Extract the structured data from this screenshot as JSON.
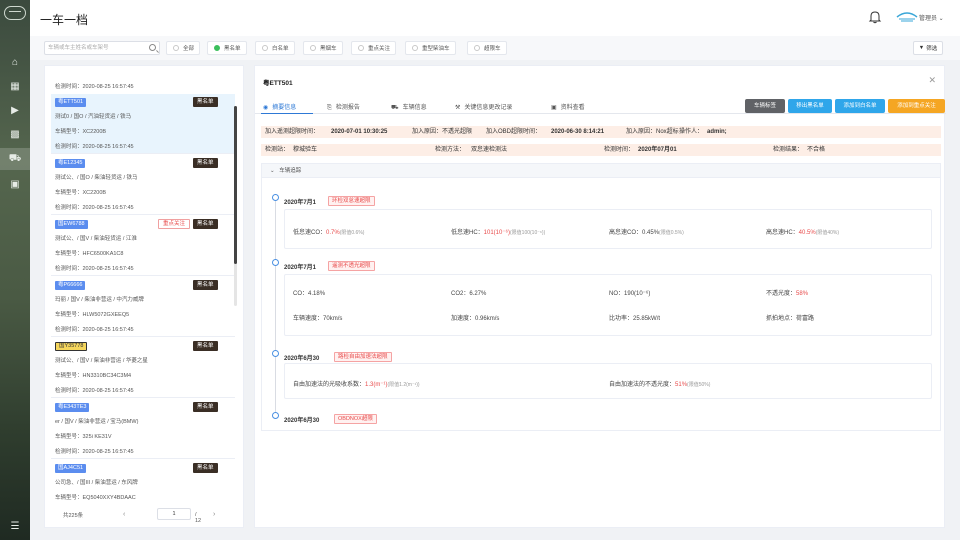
{
  "app": {
    "title": "一车一档",
    "user": "管理员"
  },
  "filters": {
    "search_placeholder": "车辆或车主姓名或车架号",
    "chips": [
      "全部",
      "黑名单",
      "白名单",
      "黑烟车",
      "重点关注",
      "重型柴油车",
      "超限车"
    ],
    "active_chip": "黑名单",
    "filter_button": "筛选"
  },
  "list": {
    "top_partial_line": "检测时间：2020-08-25 16:57:45",
    "items": [
      {
        "plate": "粤ETT501",
        "tag": "黑名单",
        "l1": "测试0 / 国O / 汽油轻货运 / 铁马",
        "l2": "车辆型号：XC2200B",
        "l3": "检测时间：2020-08-25 16:57:45"
      },
      {
        "plate": "粤E12345",
        "tag": "黑名单",
        "l1": "测试公、/ 国O / 柴油轻货运 / 铁马",
        "l2": "车辆型号：XC2200B",
        "l3": "检测时间：2020-08-25 16:57:45"
      },
      {
        "plate": "国EW6788",
        "tag": "黑名单",
        "tag2": "重点关注",
        "l1": "测试公、/ 国V / 柴油轻货运 / 江淮",
        "l2": "车辆型号：HFC6500KA1C8",
        "l3": "检测时间：2020-08-25 16:57:45"
      },
      {
        "plate": "粤P66666",
        "tag": "黑名单",
        "l1": "玛丽 / 国V / 柴油非营运 / 中汽力威牌",
        "l2": "车辆型号：HLW5072GXEEQ5",
        "l3": "检测时间：2020-08-25 16:57:45"
      },
      {
        "plate": "国Y35778",
        "tag": "黑名单",
        "l1": "测试公、/ 国V / 柴油非营运 / 华菱之星",
        "l2": "车辆型号：HN3310BC34C3M4",
        "l3": "检测时间：2020-08-25 16:57:45"
      },
      {
        "plate": "粤E343TE3",
        "tag": "黑名单",
        "l1": "er / 国V / 柴油非营运 / 宝马(BMW)",
        "l2": "车辆型号：325i KE31V",
        "l3": "检测时间：2020-08-25 16:57:45"
      },
      {
        "plate": "国AJ4C51",
        "tag": "黑名单",
        "l1": "公司急、/ 国III / 柴油营运 / 东风牌",
        "l2": "车辆型号：EQ5040XXY4BDAAC",
        "l3": ""
      }
    ],
    "total": "共225条",
    "page": "1",
    "pages": "/ 12"
  },
  "detail": {
    "title": "粤ETT501",
    "tabs": [
      "摘要信息",
      "检测报告",
      "车辆信息",
      "关键信息更改记录",
      "资料查看"
    ],
    "actions": [
      {
        "label": "车辆标签",
        "color": "#606266"
      },
      {
        "label": "移出黑名单",
        "color": "#2fa6ea"
      },
      {
        "label": "添加到白名单",
        "color": "#2fa6ea"
      },
      {
        "label": "添加到重点关注",
        "color": "#f5a623"
      }
    ],
    "blacklist_line": {
      "a": "加入遥测超限时间：",
      "a_v": "2020-07-01 10:30:25",
      "b": "加入原因：不透光超限",
      "c": "加入OBD超限时间：",
      "c_v": "2020-06-30 8:14:21",
      "d": "加入原因：Nox超标",
      "e": "操作人：",
      "e_v": "admin;"
    },
    "check_line": {
      "station_k": "检测站：",
      "station_v": "穆城验车",
      "method_k": "检测方法：",
      "method_v": "双怠速检测法",
      "time_k": "检测时间：",
      "time_v": "2020年07月01",
      "result_k": "检测结果：",
      "result_v": "不合格"
    },
    "timeline_header": "车辆追踪",
    "events": [
      {
        "date": "2020年7月1",
        "badge": "环检双怠速超限",
        "rows": [
          [
            {
              "k": "低怠速CO：",
              "v": "0.7%",
              "red": true,
              "lim": "(限值0.6%)"
            },
            {
              "k": "低怠速HC：",
              "v": "101(10⁻⁶)",
              "red": true,
              "lim": "(限值100(10⁻⁶))"
            },
            {
              "k": "高怠速CO：",
              "v": "0.45%",
              "red": false,
              "lim": "(限值0.5%)"
            },
            {
              "k": "高怠速HC：",
              "v": "40.5%",
              "red": true,
              "lim": "(限值40%)"
            }
          ]
        ]
      },
      {
        "date": "2020年7月1",
        "badge": "遥测不透光超限",
        "rows": [
          [
            {
              "k": "CO：",
              "v": "4.18%"
            },
            {
              "k": "CO2：",
              "v": "6.27%"
            },
            {
              "k": "NO：",
              "v": "190(10⁻⁶)"
            },
            {
              "k": "不透光度：",
              "v": "58%",
              "red": true
            }
          ],
          [
            {
              "k": "车辆速度：",
              "v": "70km/s"
            },
            {
              "k": "加速度：",
              "v": "0.96km/s"
            },
            {
              "k": "比功率：",
              "v": "25.85kW/t"
            },
            {
              "k": "抓拍地点：",
              "v": "荷富路"
            }
          ]
        ]
      },
      {
        "date": "2020年6月30",
        "badge": "路检自由加速法超限",
        "rows": [
          [
            {
              "k": "自由加速法的光吸收系数：",
              "v": "1.3(m⁻¹)",
              "red": true,
              "lim": "(限值1.2(m⁻¹))"
            },
            {
              "k": "自由加速法的不透光度：",
              "v": "51%",
              "red": true,
              "lim": "(限值50%)"
            }
          ]
        ]
      },
      {
        "date": "2020年6月30",
        "badge": "OBDNOX超限",
        "rows": []
      }
    ]
  },
  "icons": [
    "home-icon",
    "chart-icon",
    "video-icon",
    "stats-icon",
    "car-icon",
    "profile-icon",
    "menu-icon",
    "bell-icon",
    "close-icon",
    "search-icon",
    "filter-icon"
  ]
}
